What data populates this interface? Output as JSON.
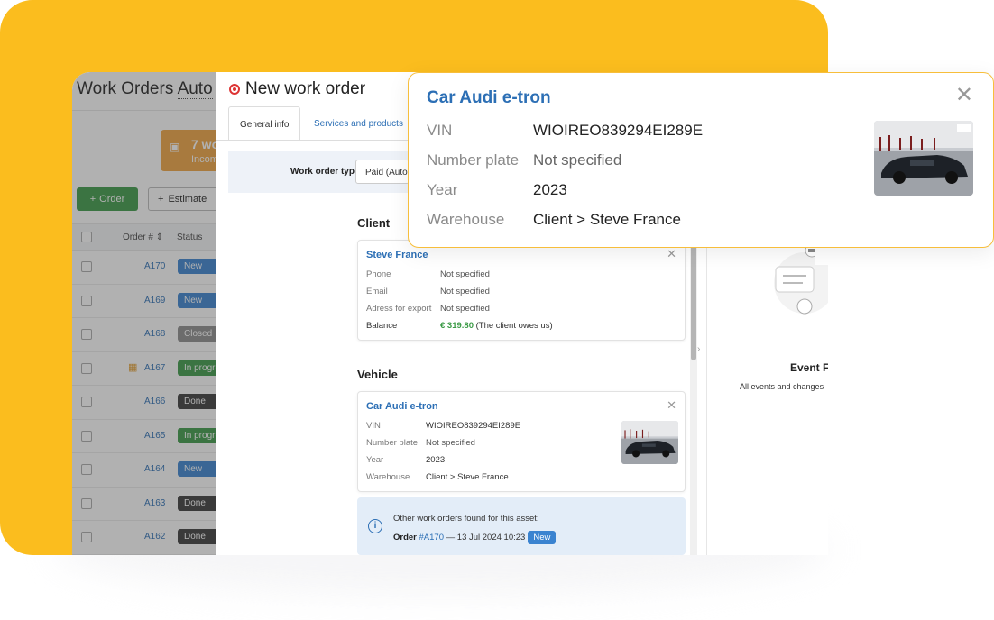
{
  "colors": {
    "brand_yellow": "#fbbd1e",
    "link_blue": "#2c6fb5",
    "green": "#3b9a46",
    "closed_gray": "#8c8c8c",
    "dark_badge": "#3a3a3a"
  },
  "list": {
    "title_prefix": "Work Orders ",
    "title_suffix": "Auto",
    "incoming_count": "7 wo",
    "incoming_label": "Incom",
    "order_button": "Order",
    "estimate_button": "Estimate",
    "col_order": "Order #",
    "col_status": "Status",
    "rows": [
      {
        "num": "A170",
        "status": "New",
        "color": "#3a83d0",
        "warn": false
      },
      {
        "num": "A169",
        "status": "New",
        "color": "#3a83d0",
        "warn": false
      },
      {
        "num": "A168",
        "status": "Closed",
        "color": "#8c8c8c",
        "warn": false
      },
      {
        "num": "A167",
        "status": "In progress",
        "color": "#3b9a46",
        "warn": true
      },
      {
        "num": "A166",
        "status": "Done",
        "color": "#3a3a3a",
        "warn": false
      },
      {
        "num": "A165",
        "status": "In progress",
        "color": "#3b9a46",
        "warn": false
      },
      {
        "num": "A164",
        "status": "New",
        "color": "#3a83d0",
        "warn": false
      },
      {
        "num": "A163",
        "status": "Done",
        "color": "#3a3a3a",
        "warn": false
      },
      {
        "num": "A162",
        "status": "Done",
        "color": "#3a3a3a",
        "warn": false
      }
    ]
  },
  "modal": {
    "title": "New work order",
    "tabs": [
      "General info",
      "Services and products"
    ],
    "work_order_type_label": "Work order type",
    "work_order_type_value": "Paid (Auto",
    "client_heading": "Client",
    "client": {
      "name": "Steve France",
      "phone_label": "Phone",
      "phone": "Not specified",
      "email_label": "Email",
      "email": "Not specified",
      "address_label": "Adress for export",
      "address": "Not specified",
      "balance_label": "Balance",
      "balance_amount": "€ 319.80",
      "balance_note": "(The client owes us)"
    },
    "vehicle_heading": "Vehicle",
    "vehicle": {
      "name": "Car Audi e-tron",
      "vin_label": "VIN",
      "vin": "WIOIREO839294EI289E",
      "plate_label": "Number plate",
      "plate": "Not specified",
      "year_label": "Year",
      "year": "2023",
      "warehouse_label": "Warehouse",
      "warehouse": "Client > Steve France"
    },
    "other_orders": {
      "line1": "Other work orders found for this asset:",
      "order_word": "Order",
      "order_link": "#A170",
      "order_date": "— 13 Jul 2024 10:23",
      "badge": "New"
    },
    "events_title": "Event F",
    "events_sub": "All events and changes"
  },
  "popup": {
    "title": "Car Audi e-tron",
    "vin_label": "VIN",
    "vin": "WIOIREO839294EI289E",
    "plate_label": "Number plate",
    "plate": "Not specified",
    "year_label": "Year",
    "year": "2023",
    "warehouse_label": "Warehouse",
    "warehouse": "Client > Steve France"
  }
}
